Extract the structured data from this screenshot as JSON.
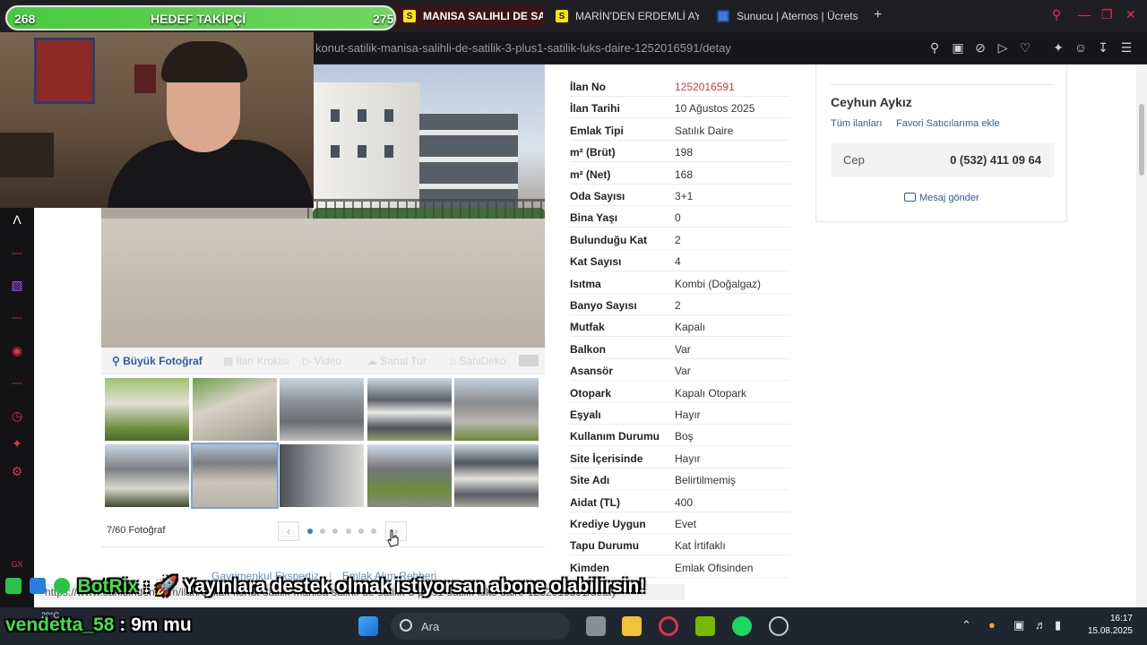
{
  "browser": {
    "tabs": [
      {
        "label": "MANISA SALIHLI DE SAT",
        "icon": "sahibinden-favicon",
        "active": true
      },
      {
        "label": "MARİN'DEN ERDEMLİ AY",
        "icon": "sahibinden-favicon",
        "active": false
      },
      {
        "label": "Sunucu | Aternos | Ücrets",
        "icon": "aternos-favicon",
        "active": false
      }
    ],
    "new_tab": "+",
    "url": "konut-satilik-manisa-salihli-de-satilik-3-plus1-satilik-luks-daire-1252016591/detay"
  },
  "overlay": {
    "goal_left": "268",
    "goal_title": "HEDEF TAKİPÇİ",
    "goal_right": "275",
    "chat_line1_name": "BotRix",
    "chat_line1_sep": " : ",
    "chat_line1_text": "🚀 Yayınlara destek olmak istiyorsan abone olabilirsin!",
    "chat_line2_name": "vendetta_58",
    "chat_line2_text": " : 9m mu"
  },
  "photo": {
    "toolbar": [
      "Büyük Fotoğraf",
      "İlan Krokisi",
      "Video",
      "Sanal Tur",
      "SahiDeko"
    ],
    "count": "7/60 Fotoğraf",
    "prev": "‹",
    "next": "›"
  },
  "footer_links": [
    "Gayrimenkul Ekspertiz",
    "Emlak Alım Rehberi"
  ],
  "status_url": "https://www.sahibinden.com/ilan/emlak-konut-satilik-manisa-salihli-de-satilik-3-plus1-satilik-luks-daire-1252016591/detay",
  "details": [
    {
      "label": "İlan No",
      "value": "1252016591"
    },
    {
      "label": "İlan Tarihi",
      "value": "10 Ağustos 2025"
    },
    {
      "label": "Emlak Tipi",
      "value": "Satılık Daire"
    },
    {
      "label": "m² (Brüt)",
      "value": "198"
    },
    {
      "label": "m² (Net)",
      "value": "168"
    },
    {
      "label": "Oda Sayısı",
      "value": "3+1"
    },
    {
      "label": "Bina Yaşı",
      "value": "0"
    },
    {
      "label": "Bulunduğu Kat",
      "value": "2"
    },
    {
      "label": "Kat Sayısı",
      "value": "4"
    },
    {
      "label": "Isıtma",
      "value": "Kombi (Doğalgaz)"
    },
    {
      "label": "Banyo Sayısı",
      "value": "2"
    },
    {
      "label": "Mutfak",
      "value": "Kapalı"
    },
    {
      "label": "Balkon",
      "value": "Var"
    },
    {
      "label": "Asansör",
      "value": "Var"
    },
    {
      "label": "Otopark",
      "value": "Kapalı Otopark"
    },
    {
      "label": "Eşyalı",
      "value": "Hayır"
    },
    {
      "label": "Kullanım Durumu",
      "value": "Boş"
    },
    {
      "label": "Site İçerisinde",
      "value": "Hayır"
    },
    {
      "label": "Site Adı",
      "value": "Belirtilmemiş"
    },
    {
      "label": "Aidat (TL)",
      "value": "400"
    },
    {
      "label": "Krediye Uygun",
      "value": "Evet"
    },
    {
      "label": "Tapu Durumu",
      "value": "Kat İrtifaklı"
    },
    {
      "label": "Kimden",
      "value": "Emlak Ofisinden"
    }
  ],
  "seller": {
    "name": "Ceyhun Aykız",
    "all_listings": "Tüm ilanları",
    "add_favorite": "Favori Satıcılarıma ekle",
    "phone_label": "Cep",
    "phone": "0 (532) 411 09 64",
    "message": "Mesaj gönder"
  },
  "taskbar": {
    "search": "Ara",
    "temp": "29°C",
    "time": "16:17",
    "date": "15.08.2025"
  },
  "colors": {
    "accent": "#e0334a",
    "link": "#2b5e9e",
    "listing_no": "#d63a3a",
    "goal_green": "#48c940"
  }
}
